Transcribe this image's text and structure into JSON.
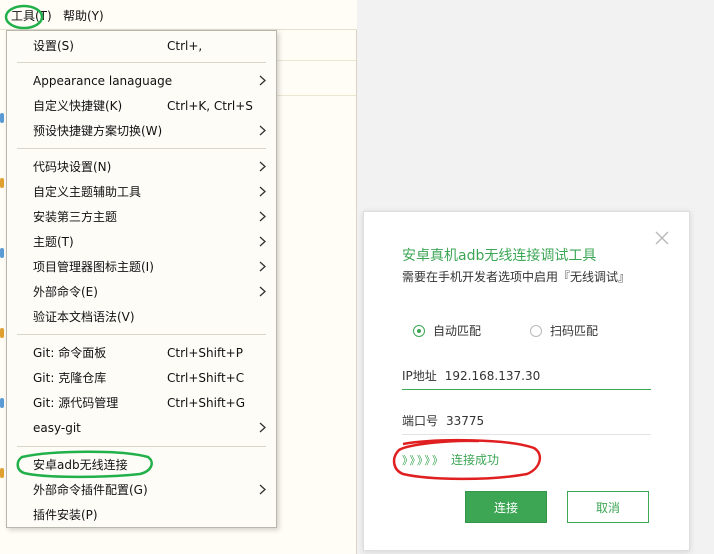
{
  "menubar": {
    "tools_label": "工具(T)",
    "help_label": "帮助(Y)"
  },
  "menu": {
    "items": [
      {
        "label": "设置(S)",
        "shortcut": "Ctrl+,",
        "submenu": false
      },
      {
        "label": "Appearance lanaguage",
        "shortcut": "",
        "submenu": true
      },
      {
        "label": "自定义快捷键(K)",
        "shortcut": "Ctrl+K, Ctrl+S",
        "submenu": false
      },
      {
        "label": "预设快捷键方案切换(W)",
        "shortcut": "",
        "submenu": true
      },
      {
        "label": "代码块设置(N)",
        "shortcut": "",
        "submenu": true
      },
      {
        "label": "自定义主题辅助工具",
        "shortcut": "",
        "submenu": true
      },
      {
        "label": "安装第三方主题",
        "shortcut": "",
        "submenu": true
      },
      {
        "label": "主题(T)",
        "shortcut": "",
        "submenu": true
      },
      {
        "label": "项目管理器图标主题(I)",
        "shortcut": "",
        "submenu": true
      },
      {
        "label": "外部命令(E)",
        "shortcut": "",
        "submenu": true
      },
      {
        "label": "验证本文档语法(V)",
        "shortcut": "",
        "submenu": false
      },
      {
        "label": "Git: 命令面板",
        "shortcut": "Ctrl+Shift+P",
        "submenu": false
      },
      {
        "label": "Git: 克隆仓库",
        "shortcut": "Ctrl+Shift+C",
        "submenu": false
      },
      {
        "label": "Git: 源代码管理",
        "shortcut": "Ctrl+Shift+G",
        "submenu": false
      },
      {
        "label": "easy-git",
        "shortcut": "",
        "submenu": true
      },
      {
        "label": "安卓adb无线连接",
        "shortcut": "",
        "submenu": false
      },
      {
        "label": "外部命令插件配置(G)",
        "shortcut": "",
        "submenu": true
      },
      {
        "label": "插件安装(P)",
        "shortcut": "",
        "submenu": false
      }
    ]
  },
  "dialog": {
    "title": "安卓真机adb无线连接调试工具",
    "subtitle": "需要在手机开发者选项中启用『无线调试』",
    "radio_auto": "自动匹配",
    "radio_scan": "扫码匹配",
    "radio_selected": "自动匹配",
    "ip_label": "IP地址",
    "ip_value": "192.168.137.30",
    "port_label": "端口号",
    "port_value": "33775",
    "status_arrows": "》》》》》",
    "status_text": "连接成功",
    "connect_button": "连接",
    "cancel_button": "取消"
  },
  "colors": {
    "accent_green": "#3ca655",
    "annotation_red": "#e02020",
    "annotation_green": "#22b04b"
  }
}
